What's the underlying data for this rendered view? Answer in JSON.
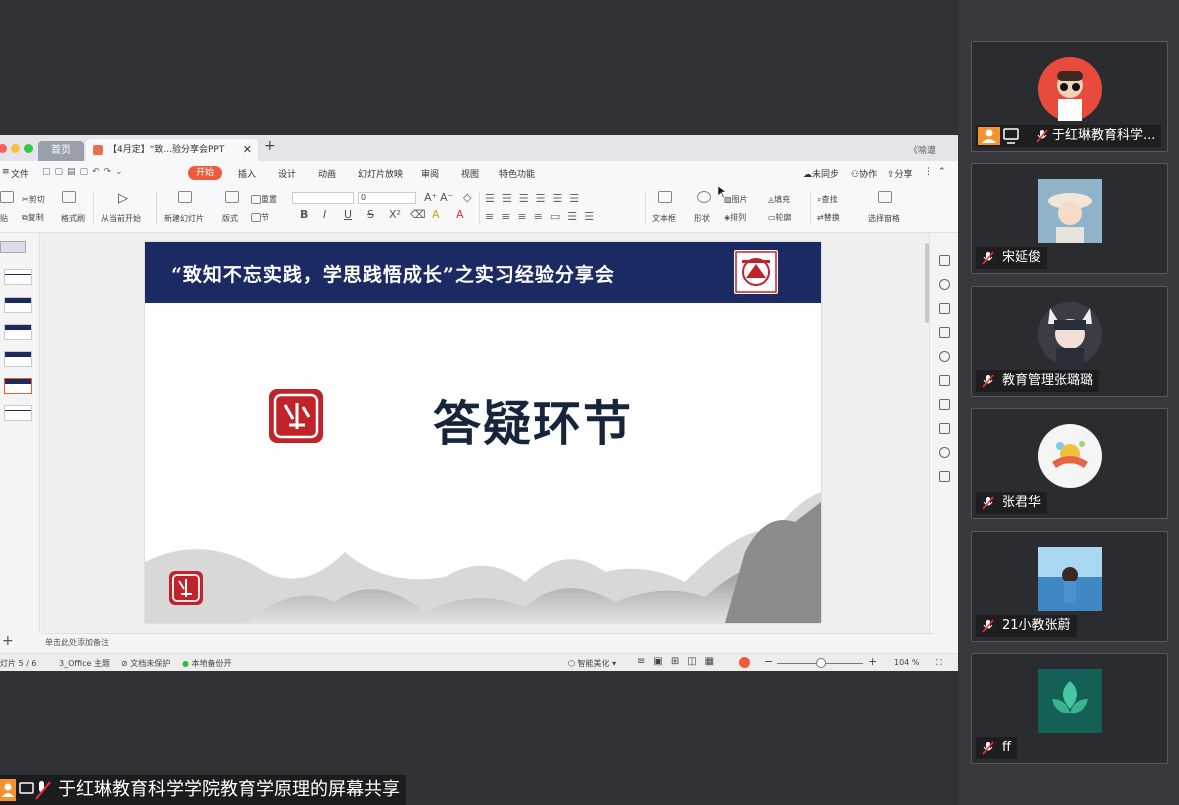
{
  "wps": {
    "tabs": {
      "home": "首页",
      "doc": "【4月定】“致...验分享会PPT",
      "right": "《喻遭"
    },
    "menu": {
      "file": "文件",
      "items": [
        "开始",
        "插入",
        "设计",
        "动画",
        "幻灯片放映",
        "审阅",
        "视图",
        "特色功能"
      ],
      "sync": "未同步",
      "collab": "协作",
      "share": "分享"
    },
    "toolbar": {
      "paste": "贴",
      "cut": "剪切",
      "copy": "复制",
      "format_painter": "格式刷",
      "from_current": "从当前开始",
      "new_slide": "新建幻灯片",
      "layout": "版式",
      "section": "节",
      "reset": "重置",
      "font_size": "0",
      "text_box": "文本框",
      "shape": "形状",
      "picture": "图片",
      "arrange": "排列",
      "fill": "填充",
      "outline": "轮廓",
      "find": "查找",
      "replace": "替换",
      "select_pane": "选择窗格"
    },
    "slide": {
      "banner": "“致知不忘实践，学思践悟成长”之实习经验分享会",
      "title": "答疑环节"
    },
    "notes_placeholder": "单击此处添加备注",
    "status": {
      "slide_count": "灯片 5 / 6",
      "theme": "3_Office 主题",
      "protect": "文档未保护",
      "backup": "本地备份开",
      "beautify": "智能美化",
      "zoom": "104 %"
    }
  },
  "participants": [
    {
      "name": "于红琳教育科学...",
      "avatar_color": "#e84b3c"
    },
    {
      "name": "宋延俊",
      "avatar_color": "#d9c9b4"
    },
    {
      "name": "教育管理张璐璐",
      "avatar_color": "#3b3c46"
    },
    {
      "name": "张君华",
      "avatar_color": "#f5f5f5"
    },
    {
      "name": "21小教张蔚",
      "avatar_color": "#4ea1d8"
    },
    {
      "name": "ff",
      "avatar_color": "#1f9c86"
    }
  ],
  "screen_share_label": "于红琳教育科学学院教育学原理的屏幕共享"
}
